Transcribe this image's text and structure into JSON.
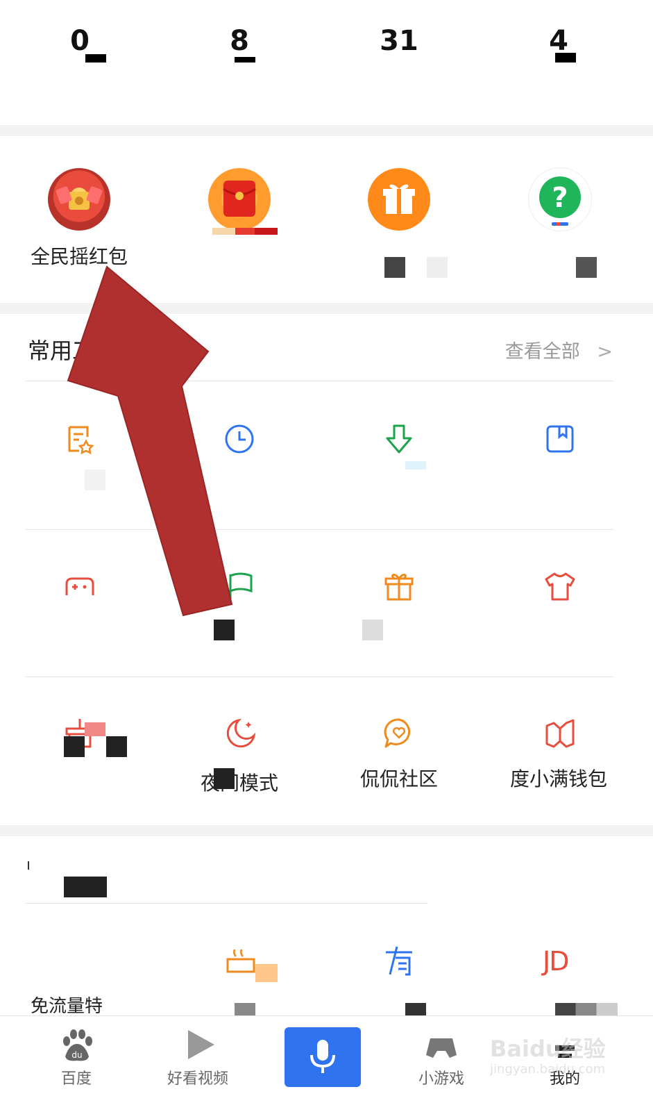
{
  "stats": {
    "counts": [
      "0",
      "8",
      "31",
      "4"
    ]
  },
  "activities": [
    {
      "label": "全民摇红包"
    },
    {
      "label": ""
    },
    {
      "label": ""
    },
    {
      "label": ""
    }
  ],
  "tools": {
    "title": "常用工",
    "view_all": "查看全部",
    "rows": [
      [
        {
          "icon": "document-star-icon",
          "label": ""
        },
        {
          "icon": "clock-icon",
          "label": ""
        },
        {
          "icon": "download-icon",
          "label": ""
        },
        {
          "icon": "bookmark-icon",
          "label": ""
        }
      ],
      [
        {
          "icon": "gamepad-icon",
          "label": ""
        },
        {
          "icon": "flag-icon",
          "label": ""
        },
        {
          "icon": "gift-icon",
          "label": ""
        },
        {
          "icon": "shirt-icon",
          "label": ""
        }
      ],
      [
        {
          "icon": "clean-icon",
          "label": ""
        },
        {
          "icon": "night-mode-icon",
          "label": "夜间模式"
        },
        {
          "icon": "chat-heart-icon",
          "label": "侃侃社区"
        },
        {
          "icon": "wallet-icon",
          "label": "度小满钱包"
        }
      ]
    ]
  },
  "partner_section": {
    "items": [
      {
        "label": "免流量特"
      },
      {
        "icon": "pot-icon",
        "label": ""
      },
      {
        "icon": "you-icon",
        "label": ""
      },
      {
        "icon": "jd-logo-icon",
        "brand": "JD",
        "label": ""
      }
    ]
  },
  "bottom_nav": {
    "items": [
      {
        "icon": "baidu-paw-icon",
        "brand": "du",
        "label": "百度"
      },
      {
        "icon": "play-icon",
        "label": "好看视频"
      },
      {
        "icon": "microphone-icon",
        "label": ""
      },
      {
        "icon": "gamepad-icon",
        "label": "小游戏"
      },
      {
        "icon": "user-icon",
        "label": "我的"
      }
    ]
  },
  "watermark": {
    "brand": "Baidu经验",
    "sub": "jingyan.baidu.com"
  },
  "colors": {
    "arrow": "#b03030",
    "orange": "#f08a1c",
    "red": "#e84c3d",
    "blue": "#2f73f0",
    "green": "#1aa34a"
  }
}
